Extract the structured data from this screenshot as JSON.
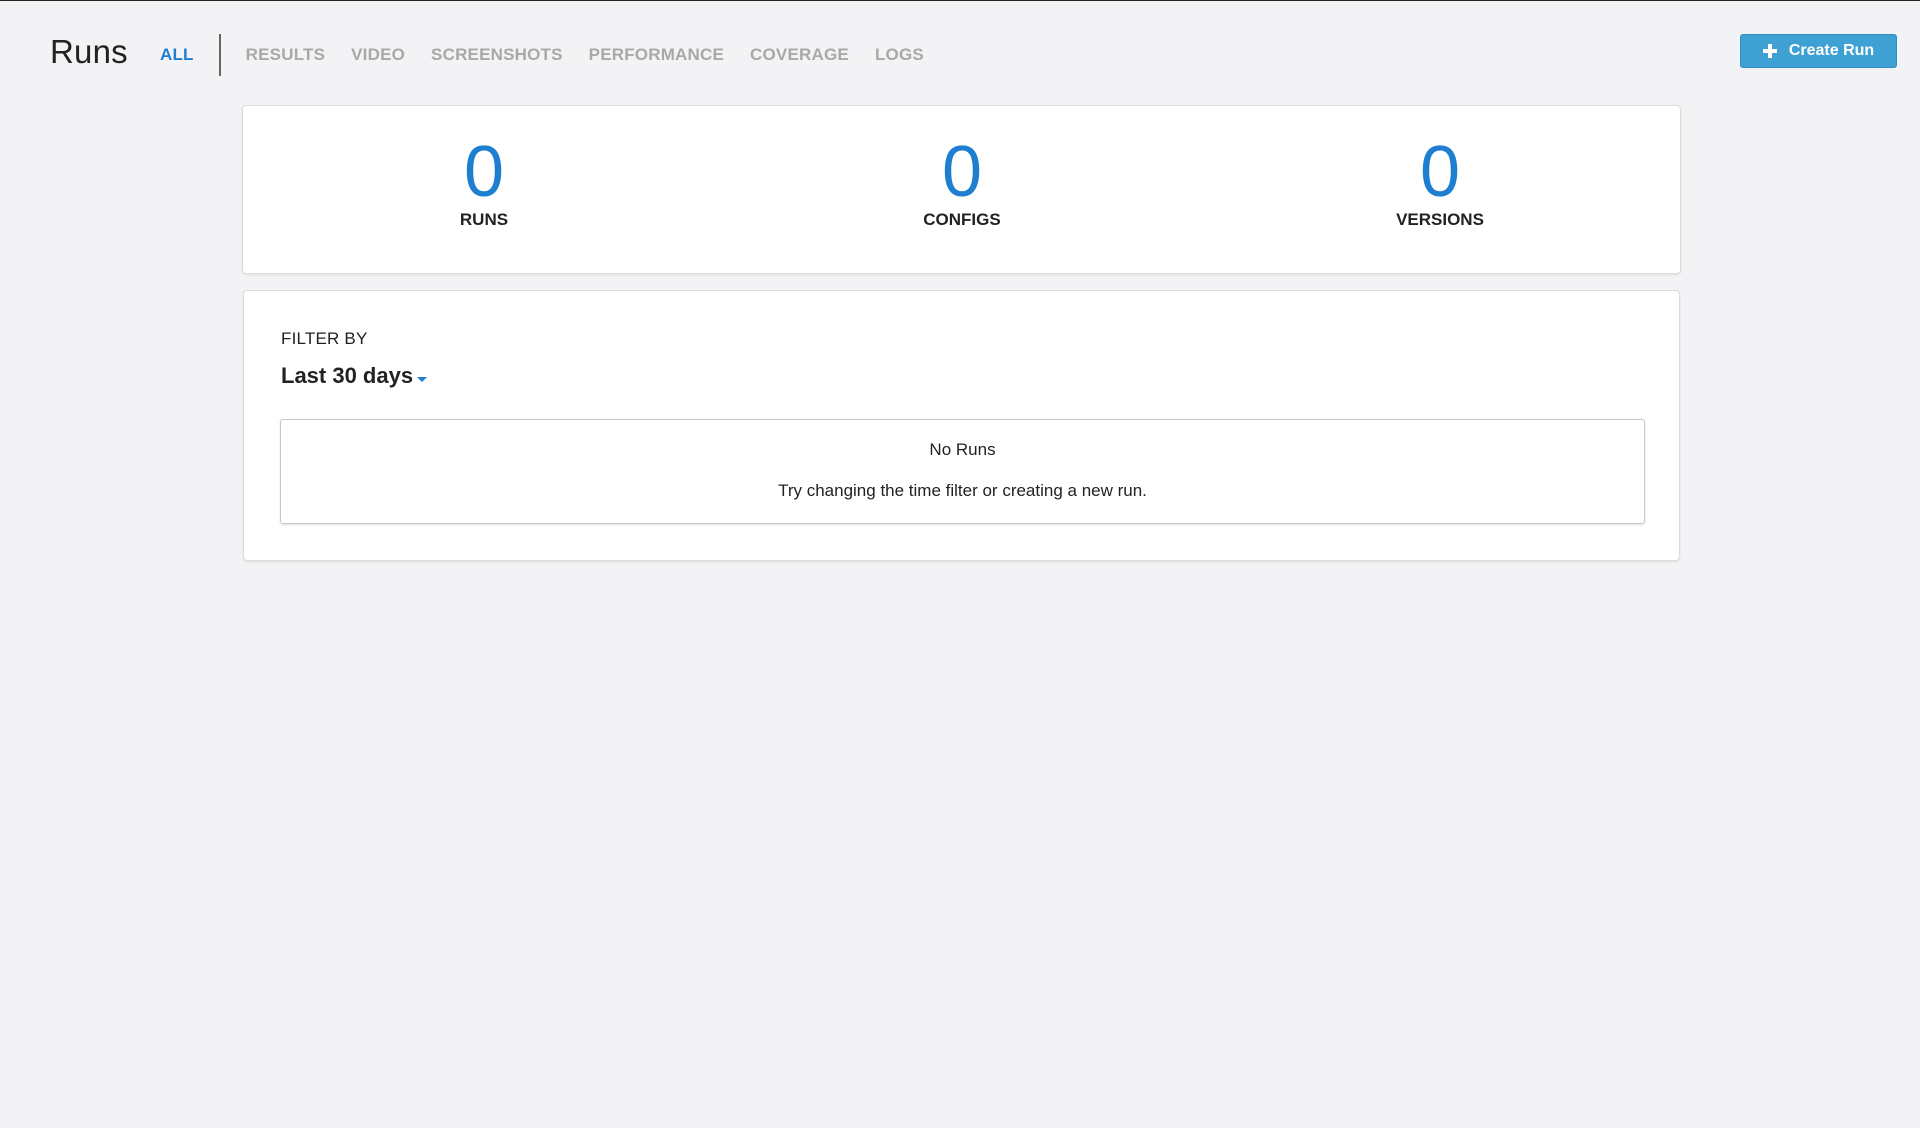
{
  "header": {
    "title": "Runs",
    "tabs": [
      {
        "label": "ALL",
        "active": true
      },
      {
        "label": "RESULTS"
      },
      {
        "label": "VIDEO"
      },
      {
        "label": "SCREENSHOTS"
      },
      {
        "label": "PERFORMANCE"
      },
      {
        "label": "COVERAGE"
      },
      {
        "label": "LOGS"
      }
    ],
    "create_button_label": "Create Run",
    "create_button_icon": "plus-icon"
  },
  "stats": [
    {
      "value": "0",
      "label": "RUNS"
    },
    {
      "value": "0",
      "label": "CONFIGS"
    },
    {
      "value": "0",
      "label": "VERSIONS"
    }
  ],
  "filter": {
    "label": "FILTER BY",
    "selected": "Last 30 days",
    "caret_icon": "chevron-down-icon"
  },
  "empty_state": {
    "title": "No Runs",
    "description": "Try changing the time filter or creating a new run."
  },
  "colors": {
    "accent": "#1e7fd1",
    "button": "#3ea0d3",
    "background": "#f3f3f5",
    "inactive_tab": "#a8a8a8"
  }
}
